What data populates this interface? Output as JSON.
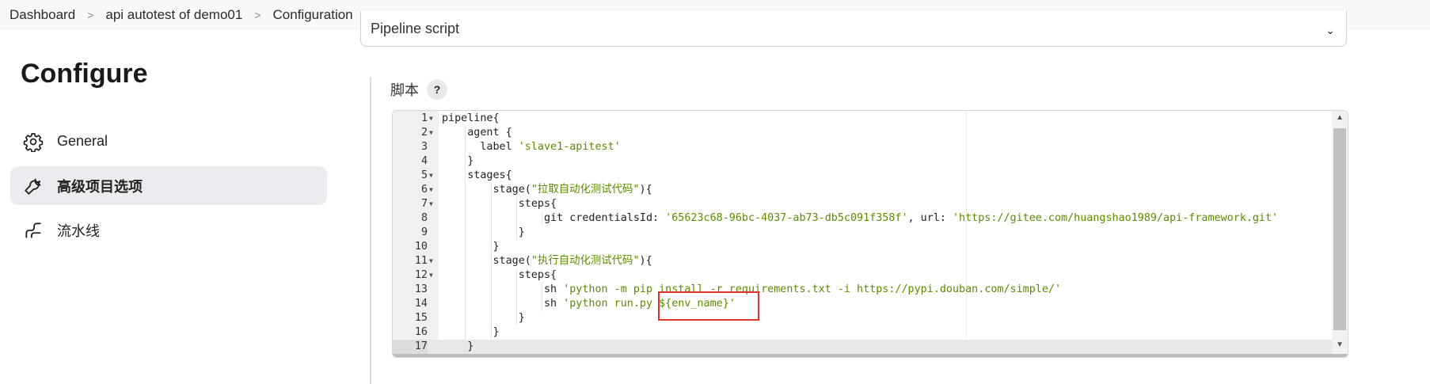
{
  "breadcrumb": [
    "Dashboard",
    "api autotest of demo01",
    "Configuration"
  ],
  "definition_select": {
    "value": "Pipeline script"
  },
  "page_title": "Configure",
  "nav": [
    {
      "label": "General",
      "icon": "gear-icon"
    },
    {
      "label": "高级项目选项",
      "icon": "wrench-icon",
      "active": true
    },
    {
      "label": "流水线",
      "icon": "pipeline-icon"
    }
  ],
  "script_field": {
    "label": "脚本",
    "help": "?"
  },
  "code_lines": [
    {
      "num": "1",
      "fold": true,
      "text": "pipeline{"
    },
    {
      "num": "2",
      "fold": true,
      "text": "    agent {"
    },
    {
      "num": "3",
      "fold": false,
      "text": "      label ",
      "str": "'slave1-apitest'"
    },
    {
      "num": "4",
      "fold": false,
      "text": "    }"
    },
    {
      "num": "5",
      "fold": true,
      "text": "    stages{"
    },
    {
      "num": "6",
      "fold": true,
      "text": "        stage(",
      "str": "\"拉取自动化测试代码\"",
      "after": "){"
    },
    {
      "num": "7",
      "fold": true,
      "text": "            steps{"
    },
    {
      "num": "8",
      "fold": false,
      "text": "                git credentialsId: ",
      "str": "'65623c68-96bc-4037-ab73-db5c091f358f'",
      "after": ", url: ",
      "str2": "'https://gitee.com/huangshao1989/api-framework.git'"
    },
    {
      "num": "9",
      "fold": false,
      "text": "            }"
    },
    {
      "num": "10",
      "fold": false,
      "text": "        }"
    },
    {
      "num": "11",
      "fold": true,
      "text": "        stage(",
      "str": "\"执行自动化测试代码\"",
      "after": "){"
    },
    {
      "num": "12",
      "fold": true,
      "text": "            steps{"
    },
    {
      "num": "13",
      "fold": false,
      "text": "                sh ",
      "str": "'python -m pip install -r requirements.txt -i https://pypi.douban.com/simple/'"
    },
    {
      "num": "14",
      "fold": false,
      "text": "                sh ",
      "str": "'python run.py ${env_name}'"
    },
    {
      "num": "15",
      "fold": false,
      "text": "            }"
    },
    {
      "num": "16",
      "fold": false,
      "text": "        }"
    },
    {
      "num": "17",
      "fold": false,
      "text": "    }",
      "active": true
    }
  ],
  "colors": {
    "string": "#5e8a00",
    "highlight_box": "#e23131",
    "active_nav_bg": "#ececf0"
  }
}
